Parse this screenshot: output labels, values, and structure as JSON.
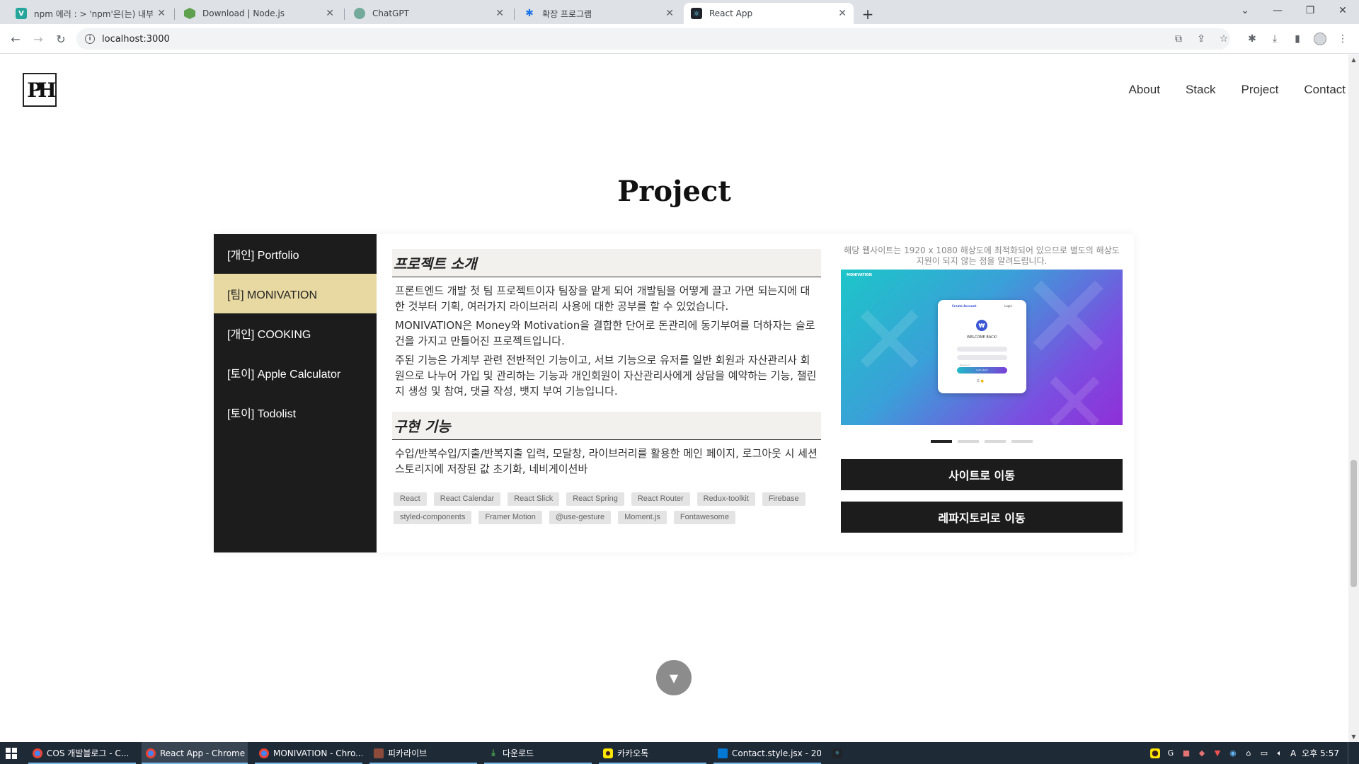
{
  "browser": {
    "tabs": [
      {
        "label": "npm 에러 : > 'npm'은(는) 내부",
        "icon": "v-site-icon",
        "color": "#26a69a",
        "glyph": "V"
      },
      {
        "label": "Download | Node.js",
        "icon": "nodejs-icon",
        "color": "#5fa04e",
        "glyph": ""
      },
      {
        "label": "ChatGPT",
        "icon": "chatgpt-icon",
        "color": "#74aa9c",
        "glyph": ""
      },
      {
        "label": "확장 프로그램",
        "icon": "puzzle-icon",
        "color": "#1a73e8",
        "glyph": ""
      },
      {
        "label": "React App",
        "icon": "react-icon",
        "color": "#20232a",
        "glyph": ""
      }
    ],
    "url": "localhost:3000"
  },
  "site": {
    "logo": "PH",
    "nav": [
      "About",
      "Stack",
      "Project",
      "Contact"
    ],
    "section_title": "Project",
    "projects": [
      {
        "label": "[개인] Portfolio"
      },
      {
        "label": "[팀] MONIVATION"
      },
      {
        "label": "[개인] COOKING"
      },
      {
        "label": "[토이] Apple Calculator"
      },
      {
        "label": "[토이] Todolist"
      }
    ],
    "active_project": "[팀] MONIVATION",
    "intro_heading": "프로젝트 소개",
    "intro_paragraphs": [
      "프론트엔드 개발 첫 팀 프로젝트이자 팀장을 맡게 되어 개발팀을 어떻게 끌고 가면 되는지에 대한 것부터 기획, 여러가지 라이브러리 사용에 대한 공부를 할 수 있었습니다.",
      "MONIVATION은 Money와 Motivation을 결합한 단어로 돈관리에 동기부여를 더하자는 슬로건을 가지고 만들어진 프로젝트입니다.",
      "주된 기능은 가계부 관련 전반적인 기능이고, 서브 기능으로 유저를 일반 회원과 자산관리사 회원으로 나누어 가입 및 관리하는 기능과 개인회원이 자산관리사에게 상담을 예약하는 기능, 챌린지 생성 및 참여, 댓글 작성, 뱃지 부여 기능입니다."
    ],
    "feature_heading": "구현 기능",
    "feature_text": "수입/반복수입/지출/반복지출 입력, 모달창, 라이브러리를 활용한 메인 페이지, 로그아웃 시 세션스토리지에 저장된 값 초기화, 네비게이션바",
    "tags": [
      "React",
      "React Calendar",
      "React Slick",
      "React Spring",
      "React Router",
      "Redux-toolkit",
      "Firebase",
      "styled-components",
      "Framer Motion",
      "@use-gesture",
      "Moment.js",
      "Fontawesome"
    ],
    "notice": "해당 웹사이트는 1920 x 1080 해상도에 최적화되어 있으므로 별도의 해상도 지원이 되지 않는 점을 알려드립니다.",
    "slide": {
      "brand": "MONIVATION",
      "tab_create": "Create Account",
      "tab_login": "Login",
      "welcome": "WELCOME BACK!",
      "field_email": "Email",
      "field_password": "Password",
      "button": "Let's start!",
      "colors": {
        "from": "#1cc6c9",
        "to": "#8f2fd8"
      }
    },
    "slide_count": 4,
    "slide_active": 1,
    "site_button": "사이트로 이동",
    "repo_button": "레파지토리로 이동"
  },
  "taskbar": {
    "items": [
      {
        "label": "COS 개발블로그 - C...",
        "icon": "chrome-icon"
      },
      {
        "label": "React App - Chrome",
        "icon": "chrome-icon"
      },
      {
        "label": "MONIVATION - Chro...",
        "icon": "chrome-icon"
      },
      {
        "label": "피카라이브",
        "icon": "pikalive-icon"
      },
      {
        "label": "다운로드",
        "icon": "download-folder-icon"
      },
      {
        "label": "카카오톡",
        "icon": "kakaotalk-icon"
      },
      {
        "label": "Contact.style.jsx - 20...",
        "icon": "vscode-icon"
      }
    ],
    "time": "오후 5:57",
    "ime": "A"
  }
}
